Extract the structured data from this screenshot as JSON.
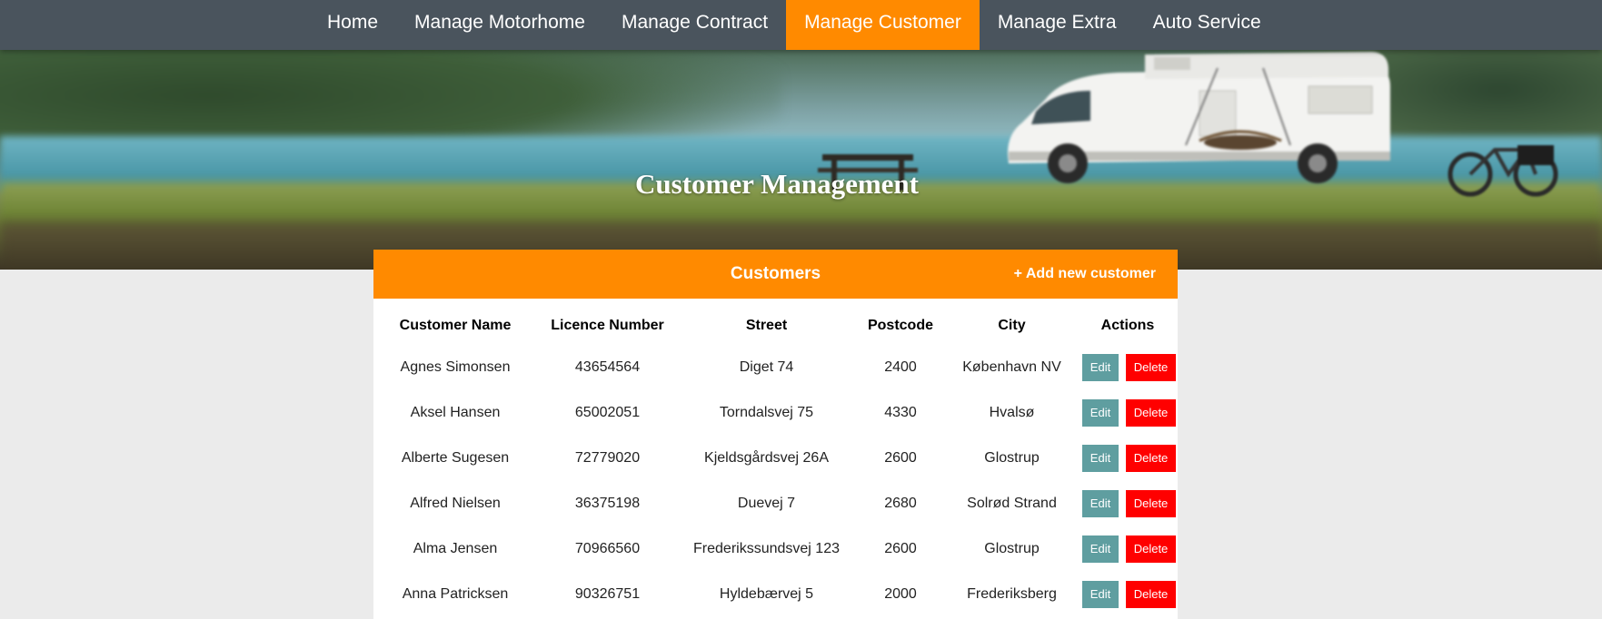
{
  "nav": {
    "items": [
      {
        "label": "Home",
        "active": false
      },
      {
        "label": "Manage Motorhome",
        "active": false
      },
      {
        "label": "Manage Contract",
        "active": false
      },
      {
        "label": "Manage Customer",
        "active": true
      },
      {
        "label": "Manage Extra",
        "active": false
      },
      {
        "label": "Auto Service",
        "active": false
      }
    ]
  },
  "hero": {
    "title": "Customer Management"
  },
  "panel": {
    "title": "Customers",
    "add_label": "+ Add new customer"
  },
  "table": {
    "headers": [
      "Customer Name",
      "Licence Number",
      "Street",
      "Postcode",
      "City",
      "Actions"
    ],
    "rows": [
      {
        "name": "Agnes Simonsen",
        "licence": "43654564",
        "street": "Diget 74",
        "postcode": "2400",
        "city": "København NV"
      },
      {
        "name": "Aksel Hansen",
        "licence": "65002051",
        "street": "Torndalsvej 75",
        "postcode": "4330",
        "city": "Hvalsø"
      },
      {
        "name": "Alberte Sugesen",
        "licence": "72779020",
        "street": "Kjeldsgårdsvej 26A",
        "postcode": "2600",
        "city": "Glostrup"
      },
      {
        "name": "Alfred Nielsen",
        "licence": "36375198",
        "street": "Duevej 7",
        "postcode": "2680",
        "city": "Solrød Strand"
      },
      {
        "name": "Alma Jensen",
        "licence": "70966560",
        "street": "Frederikssundsvej 123",
        "postcode": "2600",
        "city": "Glostrup"
      },
      {
        "name": "Anna Patricksen",
        "licence": "90326751",
        "street": "Hyldebærvej 5",
        "postcode": "2000",
        "city": "Frederiksberg"
      }
    ],
    "edit_label": "Edit",
    "delete_label": "Delete"
  },
  "colors": {
    "nav_bg": "#4a545d",
    "accent": "#ff8a00",
    "edit_btn": "#5f9ea0",
    "delete_btn": "#ff0000",
    "page_bg": "#ebebeb"
  }
}
